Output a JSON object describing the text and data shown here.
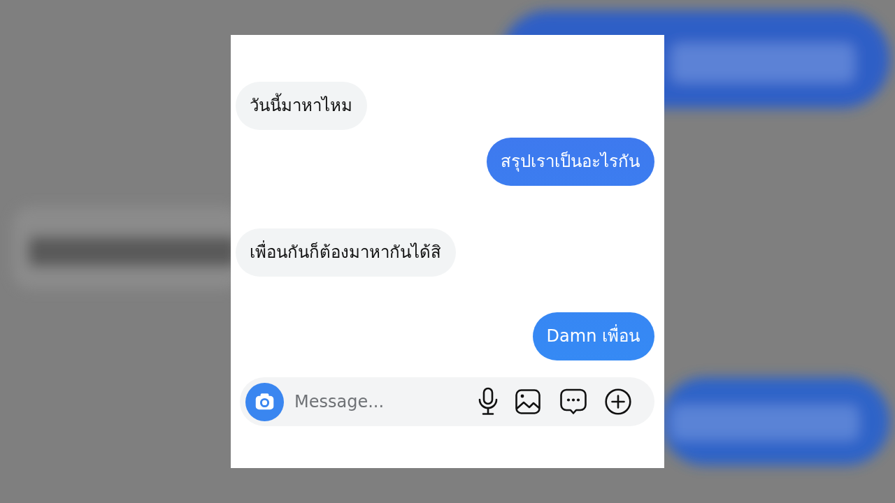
{
  "messages": [
    {
      "kind": "incoming",
      "text": "วันนี้มาหาไหม"
    },
    {
      "kind": "outgoing",
      "text": "สรุปเราเป็นอะไรกัน"
    },
    {
      "kind": "incoming",
      "text": "เพื่อนกันก็ต้องมาหากันได้สิ"
    },
    {
      "kind": "outgoing",
      "text": "Damn เพื่อน"
    }
  ],
  "composer": {
    "placeholder": "Message..."
  }
}
